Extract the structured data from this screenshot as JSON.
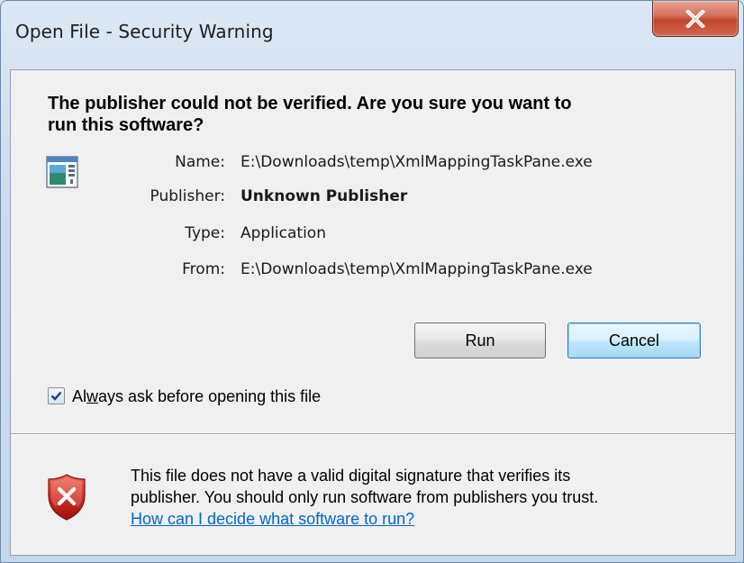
{
  "window": {
    "title": "Open File - Security Warning",
    "close_symbol": "X"
  },
  "heading": {
    "line1": "The publisher could not be verified.  Are you sure you want to",
    "line2": "run this software?"
  },
  "details": {
    "name_label": "Name:",
    "name_value": "E:\\Downloads\\temp\\XmlMappingTaskPane.exe",
    "publisher_label": "Publisher:",
    "publisher_value": "Unknown Publisher",
    "type_label": "Type:",
    "type_value": "Application",
    "from_label": "From:",
    "from_value": "E:\\Downloads\\temp\\XmlMappingTaskPane.exe",
    "app_icon": "application-icon"
  },
  "buttons": {
    "run_label": "Run",
    "cancel_label": "Cancel"
  },
  "checkbox": {
    "label_prefix": "Al",
    "label_accel": "w",
    "label_suffix": "ays ask before opening this file",
    "checked": true
  },
  "footer": {
    "warning_line1": "This file does not have a valid digital signature that verifies its",
    "warning_line2": "publisher.  You should only run software from publishers you trust.",
    "help_link": "How can I decide what software to run?",
    "icon": "shield-error-icon"
  },
  "colors": {
    "link": "#0066cc",
    "close_button": "#c2452d",
    "shield_red": "#c8251b"
  }
}
